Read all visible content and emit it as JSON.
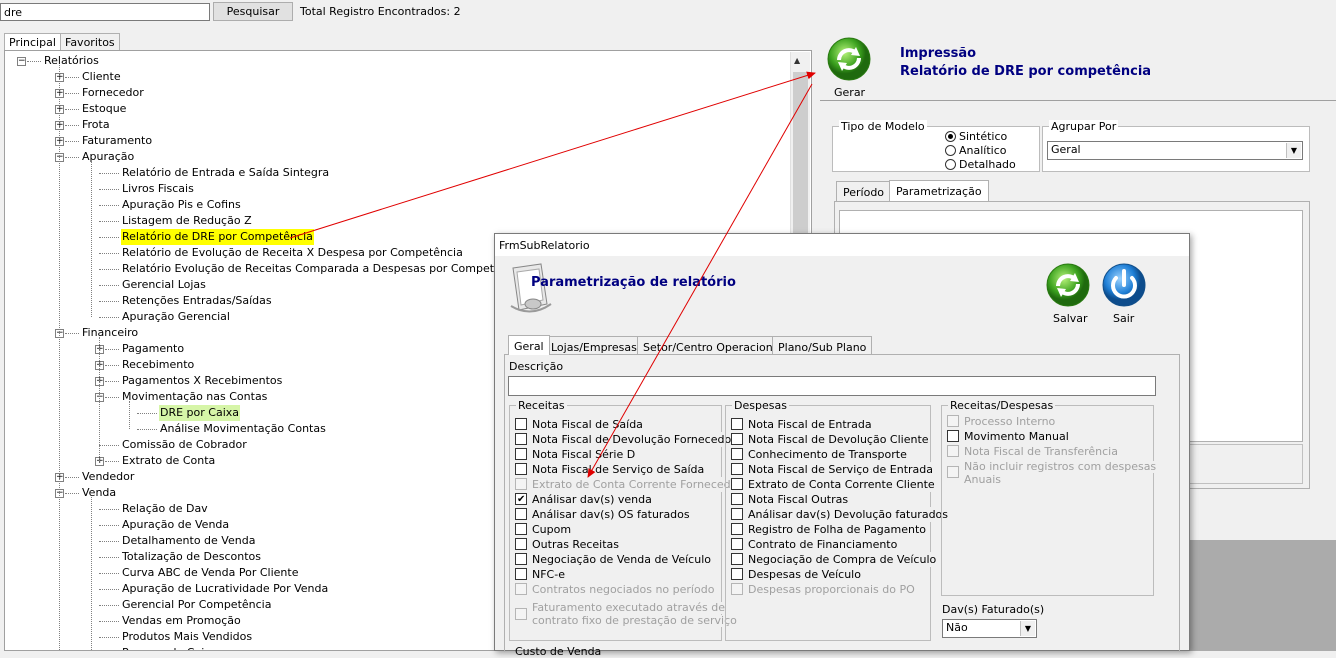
{
  "search": {
    "value": "dre",
    "button": "Pesquisar",
    "total": "Total Registro Encontrados: 2"
  },
  "left_tabs": [
    "Principal",
    "Favoritos"
  ],
  "tree": {
    "root": "Relatórios",
    "items": [
      {
        "label": "Cliente",
        "level": 1,
        "pm": "+"
      },
      {
        "label": "Fornecedor",
        "level": 1,
        "pm": "+"
      },
      {
        "label": "Estoque",
        "level": 1,
        "pm": "+"
      },
      {
        "label": "Frota",
        "level": 1,
        "pm": "+"
      },
      {
        "label": "Faturamento",
        "level": 1,
        "pm": "+"
      },
      {
        "label": "Apuração",
        "level": 1,
        "pm": "-"
      },
      {
        "label": "Relatório de Entrada e Saída Sintegra",
        "level": 2
      },
      {
        "label": "Livros Fiscais",
        "level": 2
      },
      {
        "label": "Apuração Pis e Cofins",
        "level": 2
      },
      {
        "label": "Listagem de Redução Z",
        "level": 2
      },
      {
        "label": "Relatório de DRE por Competência",
        "level": 2,
        "hl": "yellow"
      },
      {
        "label": "Relatório de Evolução de Receita X Despesa por Competência",
        "level": 2
      },
      {
        "label": "Relatório Evolução de Receitas Comparada a Despesas por Competência",
        "level": 2
      },
      {
        "label": "Gerencial Lojas",
        "level": 2
      },
      {
        "label": "Retenções Entradas/Saídas",
        "level": 2
      },
      {
        "label": "Apuração Gerencial",
        "level": 2
      },
      {
        "label": "Financeiro",
        "level": 1,
        "pm": "-"
      },
      {
        "label": "Pagamento",
        "level": 2,
        "pm": "+"
      },
      {
        "label": "Recebimento",
        "level": 2,
        "pm": "+"
      },
      {
        "label": "Pagamentos X Recebimentos",
        "level": 2,
        "pm": "+"
      },
      {
        "label": "Movimentação nas Contas",
        "level": 2,
        "pm": "-"
      },
      {
        "label": "DRE por Caixa",
        "level": 3,
        "hl": "green"
      },
      {
        "label": "Análise Movimentação Contas",
        "level": 3
      },
      {
        "label": "Comissão de Cobrador",
        "level": 2
      },
      {
        "label": "Extrato de Conta",
        "level": 2,
        "pm": "+"
      },
      {
        "label": "Vendedor",
        "level": 1,
        "pm": "+"
      },
      {
        "label": "Venda",
        "level": 1,
        "pm": "-"
      },
      {
        "label": "Relação de Dav",
        "level": 2
      },
      {
        "label": "Apuração de Venda",
        "level": 2
      },
      {
        "label": "Detalhamento de Venda",
        "level": 2
      },
      {
        "label": "Totalização de Descontos",
        "level": 2
      },
      {
        "label": "Curva ABC de Venda Por Cliente",
        "level": 2
      },
      {
        "label": "Apuração de Lucratividade Por Venda",
        "level": 2
      },
      {
        "label": "Gerencial Por Competência",
        "level": 2
      },
      {
        "label": "Vendas em Promoção",
        "level": 2
      },
      {
        "label": "Produtos Mais Vendidos",
        "level": 2
      },
      {
        "label": "Resumo de Caixa",
        "level": 2
      }
    ]
  },
  "right": {
    "gerar": "Gerar",
    "title1": "Impressão",
    "title2": "Relatório de DRE por competência",
    "tipo_modelo": "Tipo de Modelo",
    "radios": [
      "Sintético",
      "Analítico",
      "Detalhado"
    ],
    "agrupar": "Agrupar Por",
    "agrupar_value": "Geral",
    "tabs": [
      "Período",
      "Parametrização"
    ]
  },
  "dialog": {
    "window_title": "FrmSubRelatorio",
    "heading": "Parametrização de relatório",
    "salvar": "Salvar",
    "sair": "Sair",
    "tabs": [
      "Geral",
      "Lojas/Empresas",
      "Setor/Centro Operacional",
      "Plano/Sub Plano"
    ],
    "descricao_label": "Descrição",
    "descricao_value": "",
    "receitas": {
      "title": "Receitas",
      "items": [
        {
          "label": "Nota Fiscal de Saída",
          "checked": false,
          "disabled": false
        },
        {
          "label": "Nota Fiscal de Devolução Fornecedor",
          "checked": false,
          "disabled": false
        },
        {
          "label": "Nota Fiscal Série D",
          "checked": false,
          "disabled": false
        },
        {
          "label": "Nota Fiscal de Serviço de Saída",
          "checked": false,
          "disabled": false
        },
        {
          "label": "Extrato de Conta Corrente Fornecedor",
          "checked": false,
          "disabled": true
        },
        {
          "label": "Análisar dav(s) venda",
          "checked": true,
          "disabled": false
        },
        {
          "label": "Análisar dav(s) OS faturados",
          "checked": false,
          "disabled": false
        },
        {
          "label": "Cupom",
          "checked": false,
          "disabled": false
        },
        {
          "label": "Outras Receitas",
          "checked": false,
          "disabled": false
        },
        {
          "label": "Negociação de Venda de Veículo",
          "checked": false,
          "disabled": false
        },
        {
          "label": "NFC-e",
          "checked": false,
          "disabled": false
        },
        {
          "label": "Contratos negociados no período",
          "checked": false,
          "disabled": true
        }
      ],
      "extra_line1": "Faturamento executado através de",
      "extra_line2": "contrato fixo de prestação de serviço"
    },
    "despesas": {
      "title": "Despesas",
      "items": [
        {
          "label": "Nota Fiscal de Entrada",
          "checked": false,
          "disabled": false
        },
        {
          "label": "Nota Fiscal de Devolução Cliente",
          "checked": false,
          "disabled": false
        },
        {
          "label": "Conhecimento de Transporte",
          "checked": false,
          "disabled": false
        },
        {
          "label": "Nota Fiscal de Serviço de Entrada",
          "checked": false,
          "disabled": false
        },
        {
          "label": "Extrato de Conta Corrente Cliente",
          "checked": false,
          "disabled": false
        },
        {
          "label": "Nota Fiscal Outras",
          "checked": false,
          "disabled": false
        },
        {
          "label": "Análisar dav(s) Devolução faturados",
          "checked": false,
          "disabled": false
        },
        {
          "label": "Registro de Folha de Pagamento",
          "checked": false,
          "disabled": false
        },
        {
          "label": "Contrato de Financiamento",
          "checked": false,
          "disabled": false
        },
        {
          "label": "Negociação de Compra de Veículo",
          "checked": false,
          "disabled": false
        },
        {
          "label": "Despesas de Veículo",
          "checked": false,
          "disabled": false
        },
        {
          "label": "Despesas proporcionais do PO",
          "checked": false,
          "disabled": true
        }
      ]
    },
    "receitas_despesas": {
      "title": "Receitas/Despesas",
      "items": [
        {
          "label": "Processo Interno",
          "checked": false,
          "disabled": true
        },
        {
          "label": "Movimento Manual",
          "checked": false,
          "disabled": false
        },
        {
          "label": "Nota Fiscal de Transferência",
          "checked": false,
          "disabled": true
        }
      ],
      "extra_line1": "Não incluir registros com despesas",
      "extra_line2": "Anuais"
    },
    "davs_label": "Dav(s) Faturado(s)",
    "davs_value": "Não",
    "custo_label": "Custo de Venda"
  },
  "colors": {
    "highlight_yellow": "#ffff00",
    "highlight_green": "#d6f5a8",
    "title_blue": "#000080",
    "arrow_red": "#e00000"
  }
}
